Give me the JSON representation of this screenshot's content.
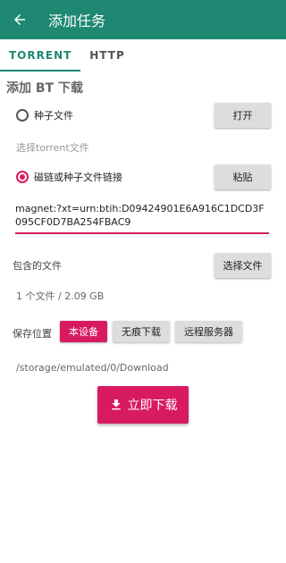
{
  "app": {
    "title": "添加任务"
  },
  "tabs": [
    {
      "label": "TORRENT",
      "active": true
    },
    {
      "label": "HTTP",
      "active": false
    }
  ],
  "section_title": "添加 BT 下载",
  "torrent_option": {
    "label": "种子文件",
    "selected": false,
    "open_button": "打开",
    "hint": "选择torrent文件"
  },
  "magnet_option": {
    "label": "磁链或种子文件链接",
    "selected": true,
    "paste_button": "粘贴",
    "value": "magnet:?xt=urn:btih:D09424901E6A916C1DCD3F095CF0D7BA254FBAC9"
  },
  "files": {
    "label": "包含的文件",
    "select_button": "选择文件",
    "summary": "1 个文件 / 2.09 GB"
  },
  "save_location": {
    "label": "保存位置",
    "options": [
      {
        "label": "本设备",
        "active": true
      },
      {
        "label": "无痕下载",
        "active": false
      },
      {
        "label": "远程服务器",
        "active": false
      }
    ],
    "path": "/storage/emulated/0/Download"
  },
  "download_button": {
    "label": "立即下载",
    "icon": "download-icon"
  },
  "colors": {
    "appbar": "#1e8872",
    "accent": "#d81b60",
    "button_gray": "#dddddd"
  }
}
